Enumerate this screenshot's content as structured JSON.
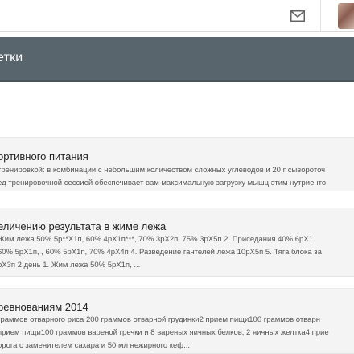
{
  "header": {
    "mail_icon": "envelope-icon",
    "avatar": "user-avatar"
  },
  "page": {
    "title": "етки"
  },
  "posts": [
    {
      "title": "ортивного питания",
      "lines": [
        "тренировкой: в комбинации с небольшим количеством сложных углеводов и 20 г сывороточ",
        "ед тренировочной сессией обеспечивает вам максимальную загрузку мышц этим нутриенто"
      ]
    },
    {
      "title": "еличению результата в жиме лежа",
      "lines": [
        "Жим лежа 50% 5р**Х1п, 60% 4рХ1п***, 70% 3рХ2п, 75% 3рХ5п 2. Приседания 40% 6рХ1",
        "60% 5рХ1п, , 60% 5рХ1п, 70% 4рХ4п 4. Разведение гантелей лежа 10рХ5п 5. Тяга блока за",
        "рХ3п 2 день 1. Жим лежа 50% 5рХ1п, ..."
      ]
    },
    {
      "title": "ревнованиям 2014",
      "lines": [
        "граммов отварного риса 200 граммов отварной грудинки2 прием пищи100 граммов отварн",
        "прием пищи100 граммов вареной гречки и 8 вареных яичных белков, 2 яичных желтка4 прие",
        "орога с заменителем сахара и 50 мл нежирного кеф..."
      ]
    }
  ]
}
